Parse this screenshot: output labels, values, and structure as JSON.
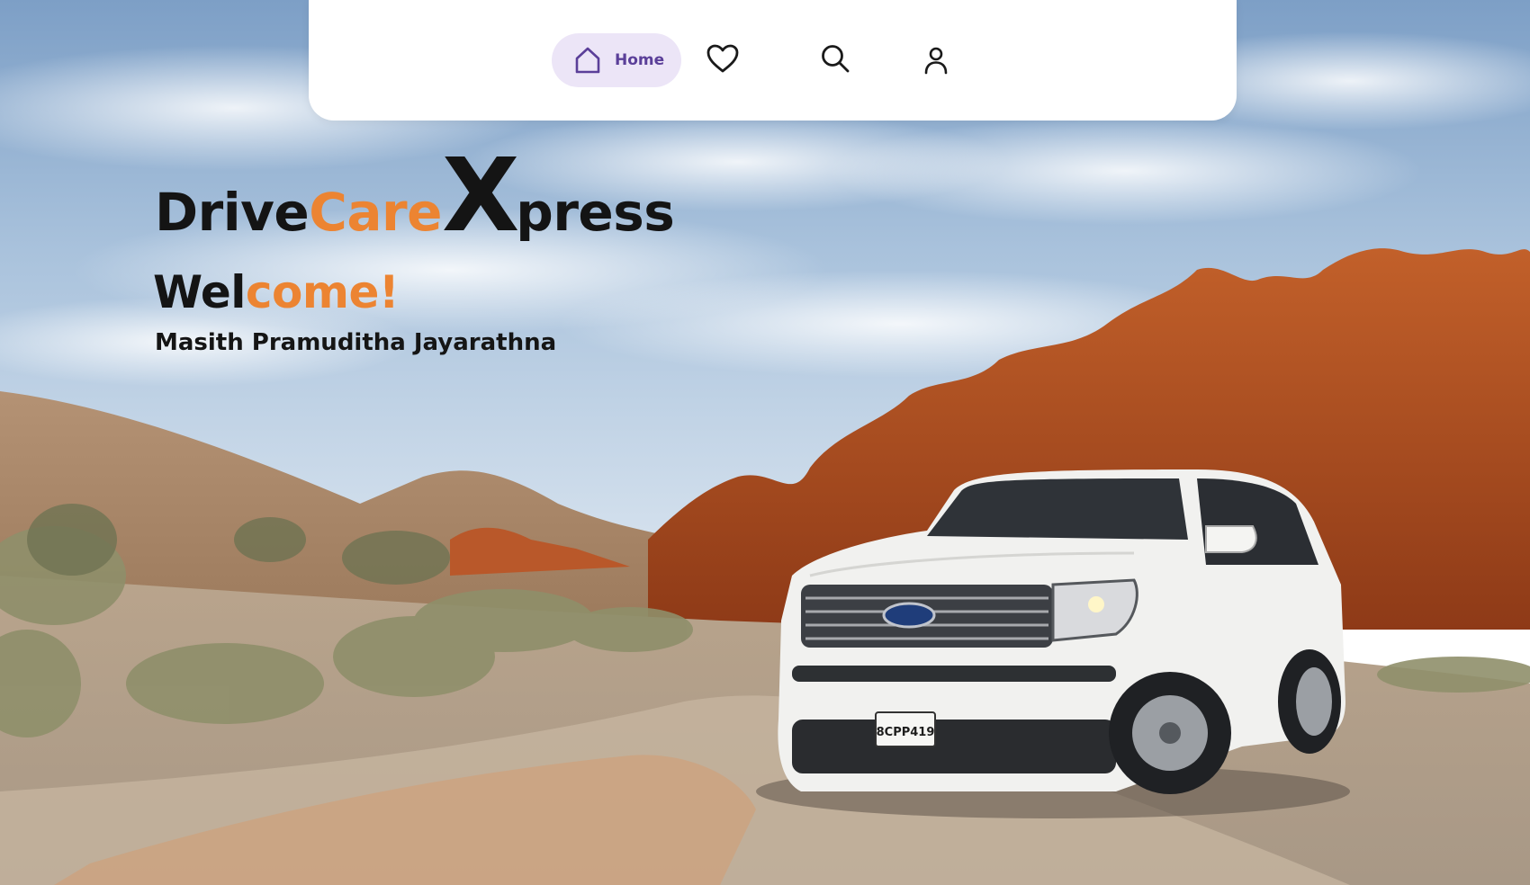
{
  "app": {
    "brand": {
      "part1": "Drive",
      "part2": "Care",
      "part3": "X",
      "part4": "press"
    },
    "accent_color": "#ec8432",
    "nav_active_color": "#5b3f99"
  },
  "nav": {
    "home": {
      "label": "Home",
      "icon": "home-icon"
    },
    "favorites": {
      "icon": "heart-icon"
    },
    "search": {
      "icon": "search-icon"
    },
    "profile": {
      "icon": "user-icon"
    }
  },
  "hero": {
    "welcome_part1": "Wel",
    "welcome_part2": "come!",
    "user_name": "Masith Pramuditha Jayarathna",
    "background": "desert-road-white-suv-photo",
    "plate_text": "8CPP419",
    "grille_badge": "Ford"
  }
}
